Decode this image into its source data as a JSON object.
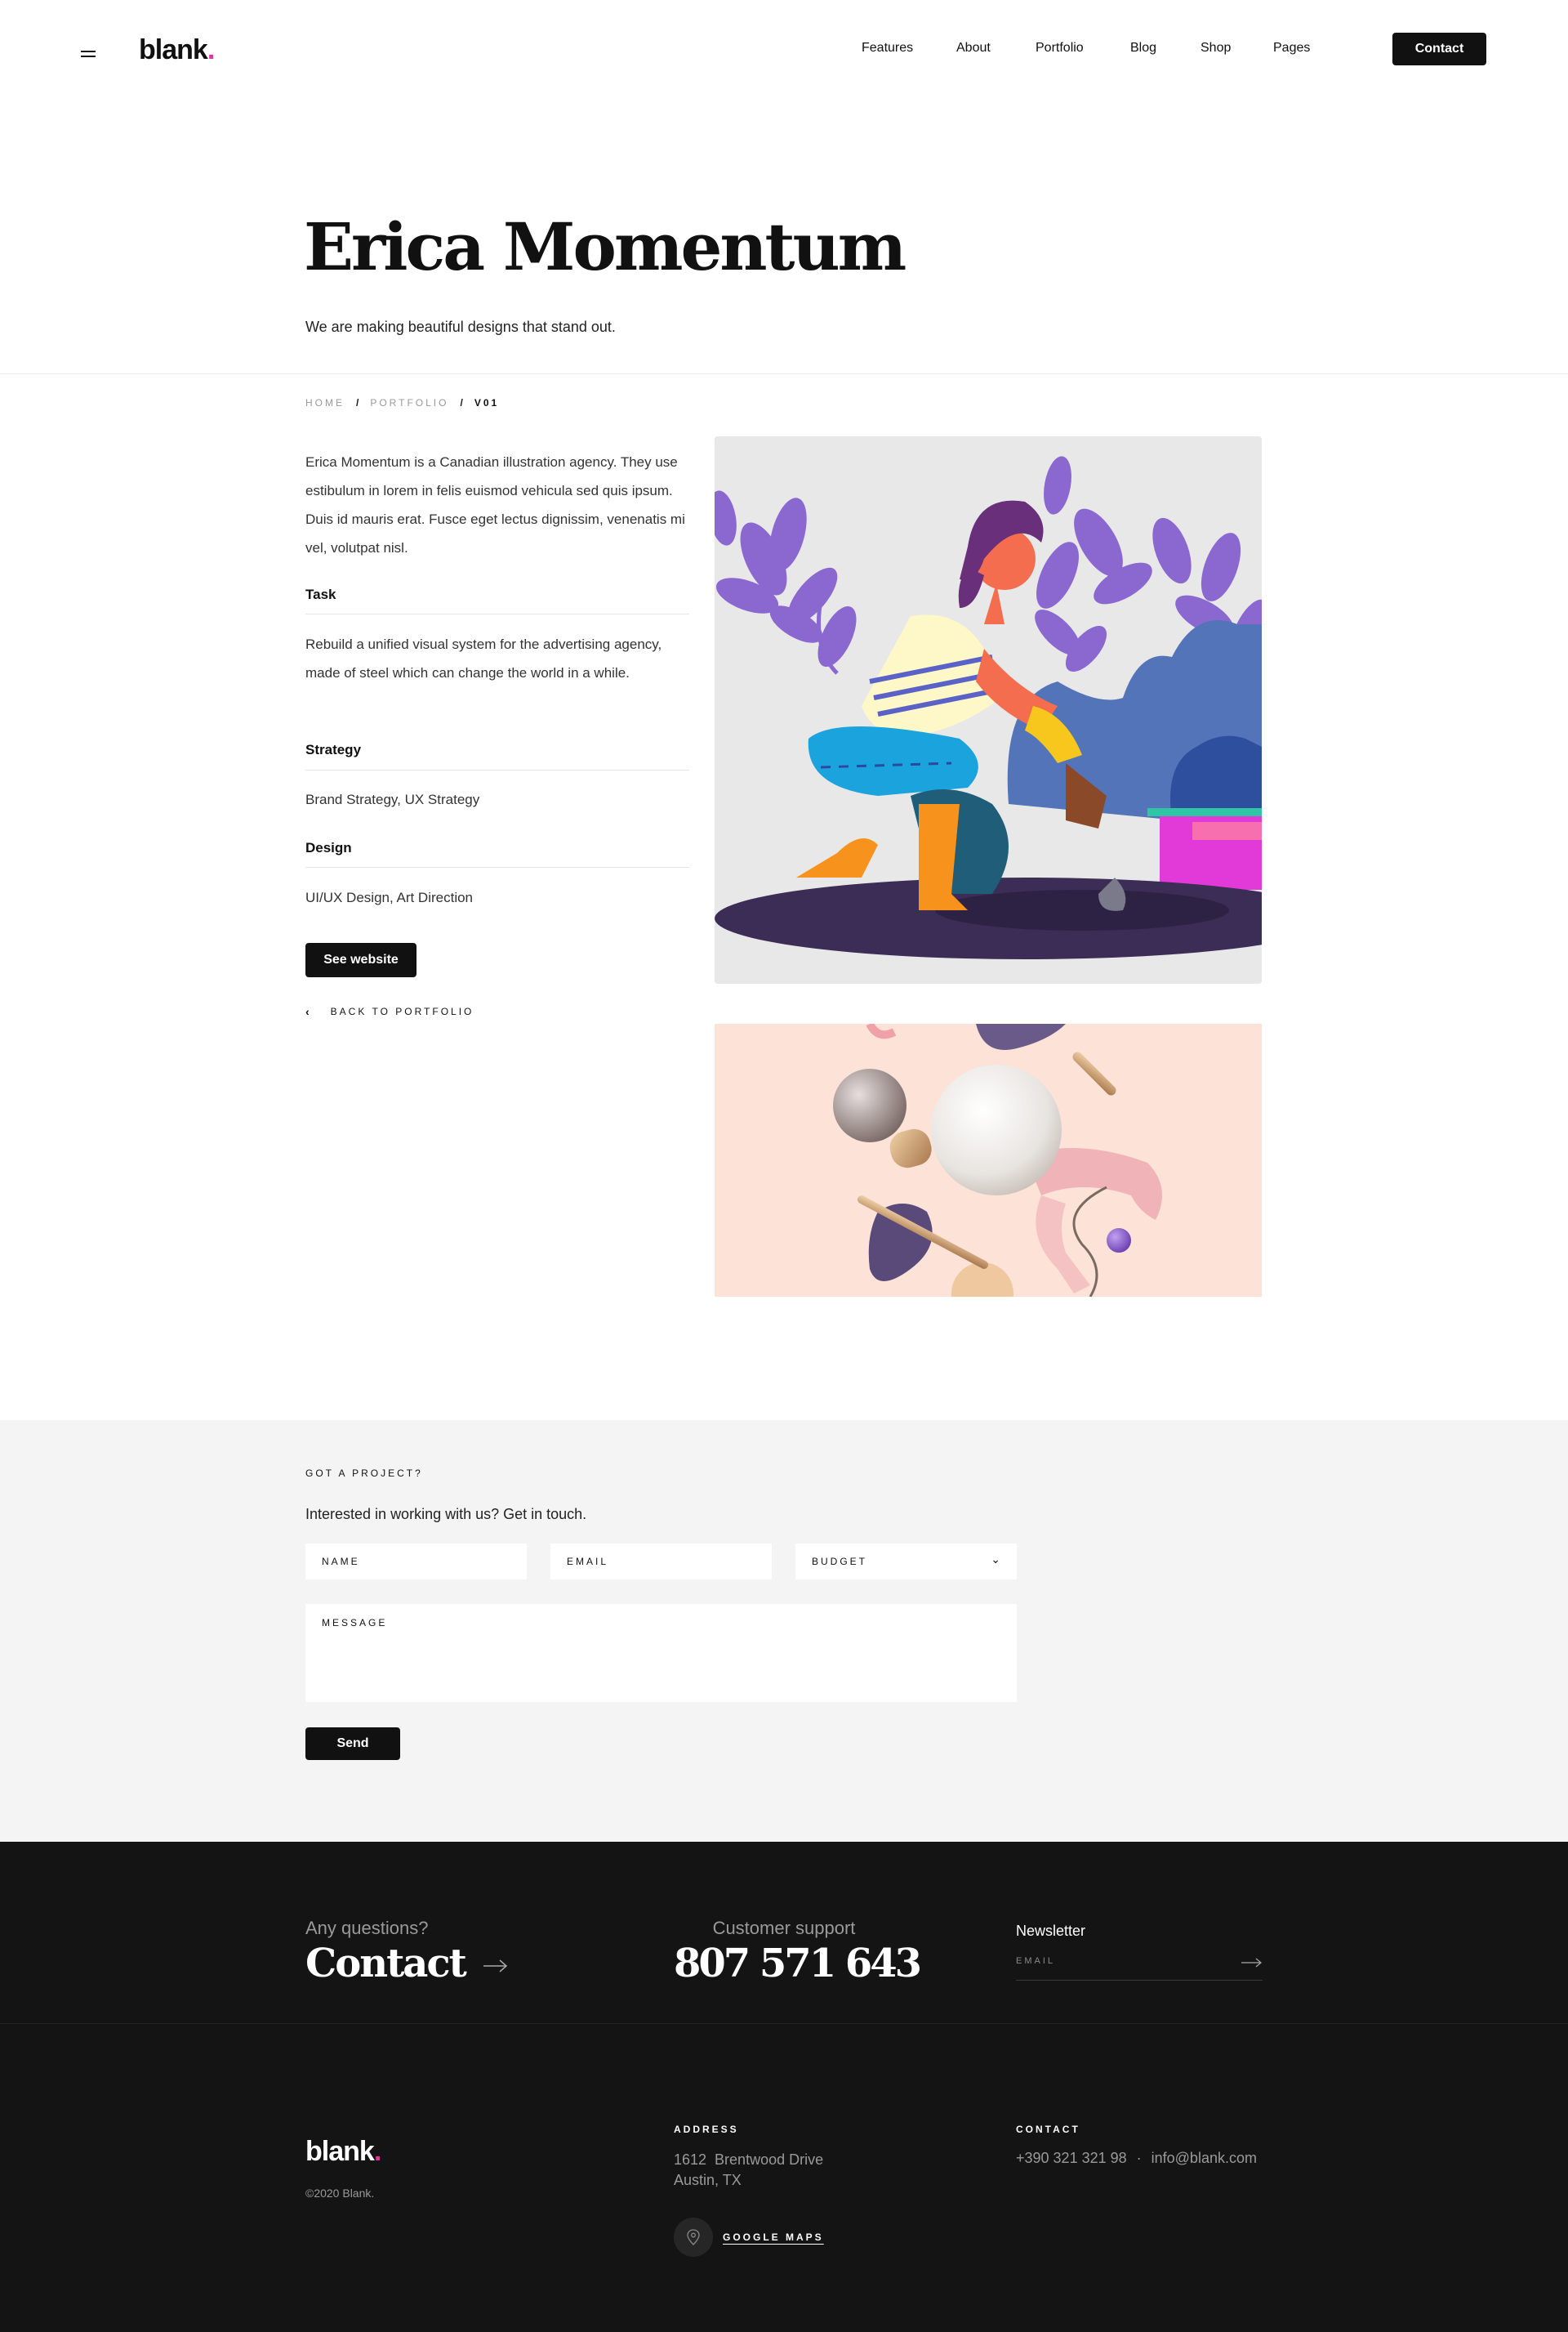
{
  "header": {
    "logo": "blank",
    "logo_dot": ".",
    "nav": [
      "Features",
      "About",
      "Portfolio",
      "Blog",
      "Shop",
      "Pages"
    ],
    "contact_label": "Contact"
  },
  "hero": {
    "title": "Erica Momentum",
    "subtitle": "We are making beautiful designs that stand out."
  },
  "breadcrumb": {
    "home": "HOME",
    "portfolio": "PORTFOLIO",
    "current": "V01",
    "separator": "/"
  },
  "project": {
    "intro": "Erica Momentum is a Canadian illustration agency. They use estibulum in lorem in felis euismod vehicula sed quis ipsum. Duis id mauris erat. Fusce eget lectus dignissim, venenatis mi vel, volutpat nisl.",
    "task_heading": "Task",
    "task_text": "Rebuild a unified visual system for the advertising agency, made of steel which can change the world in a while.",
    "strategy_heading": "Strategy",
    "strategy_text": "Brand Strategy, UX Strategy",
    "design_heading": "Design",
    "design_text": "UI/UX Design, Art Direction",
    "see_website": "See website",
    "back_label": "BACK TO PORTFOLIO"
  },
  "form": {
    "eyebrow": "GOT A PROJECT?",
    "lead": "Interested in working with us? Get in touch.",
    "name_placeholder": "NAME",
    "email_placeholder": "EMAIL",
    "budget_placeholder": "BUDGET",
    "message_placeholder": "MESSAGE",
    "send_label": "Send"
  },
  "footer": {
    "question": "Any questions?",
    "contact": "Contact",
    "support_label": "Customer support",
    "phone": "807 571 643",
    "newsletter": "Newsletter",
    "newsletter_placeholder": "EMAIL",
    "logo": "blank",
    "logo_dot": ".",
    "copyright": "©2020 Blank.",
    "address_label": "ADDRESS",
    "address_line1": "1612  Brentwood Drive",
    "address_line2": "Austin, TX",
    "maps_label": "GOOGLE MAPS",
    "contact_label": "CONTACT",
    "contact_phone": "+390 321 321 98",
    "contact_sep": "·",
    "contact_email": "info@blank.com"
  },
  "colors": {
    "accent": "#e0359b",
    "dark": "#111111",
    "footer_bg": "#141414",
    "form_bg": "#f4f4f4"
  }
}
